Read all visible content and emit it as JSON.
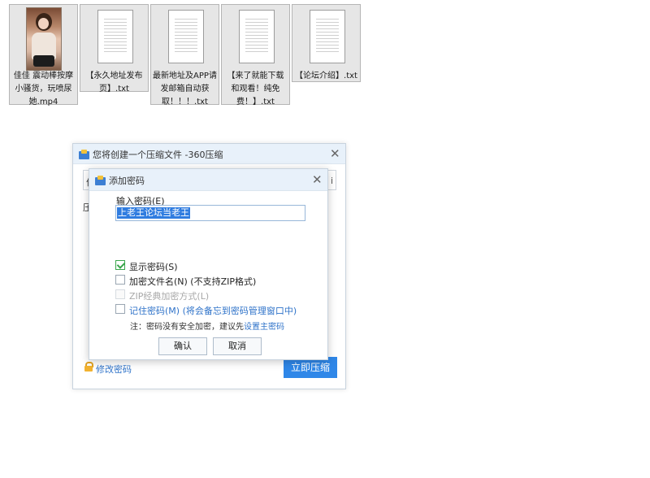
{
  "desktop": {
    "files": [
      {
        "name": "佳佳  震动棒按摩小骚货，玩喷尿她.mp4",
        "type": "video",
        "icon": "video-thumbnail"
      },
      {
        "name": "【永久地址发布页】.txt",
        "type": "text",
        "icon": "text-file-icon"
      },
      {
        "name": "最新地址及APP请发邮箱自动获取！！！.txt",
        "type": "text",
        "icon": "text-file-icon"
      },
      {
        "name": "【来了就能下载和观看！纯免费！】.txt",
        "type": "text",
        "icon": "text-file-icon"
      },
      {
        "name": "【论坛介绍】.txt",
        "type": "text",
        "icon": "text-file-icon"
      }
    ]
  },
  "compress_window": {
    "title": "您将创建一个压缩文件 -360压缩",
    "input_fragment": "佳",
    "input_fragment_end": "i",
    "compress_label_fragment": "压",
    "modify_password_link": "修改密码",
    "compress_button": "立即压缩",
    "close_glyph": "✕"
  },
  "password_dialog": {
    "title": "添加密码",
    "close_glyph": "✕",
    "input_label": "输入密码(E)",
    "password_value": "上老王论坛当老王",
    "options": {
      "show_password": {
        "label": "显示密码(S)",
        "checked": true,
        "enabled": true
      },
      "encrypt_filenames": {
        "label": "加密文件名(N) (不支持ZIP格式)",
        "checked": false,
        "enabled": true
      },
      "zip_classic": {
        "label": "ZIP经典加密方式(L)",
        "checked": false,
        "enabled": false
      },
      "remember_password": {
        "label": "记住密码(M) (将会备忘到密码管理窗口中)",
        "checked": false,
        "enabled": true
      }
    },
    "note_prefix": "注：密码没有安全加密，建议先",
    "note_link": "设置主密码",
    "confirm_button": "确认",
    "cancel_button": "取消"
  },
  "colors": {
    "titlebar": "#e8f1fa",
    "accent": "#2f87e8",
    "link": "#2f73c9",
    "check": "#39a64b",
    "selection": "#2f7ce0"
  }
}
